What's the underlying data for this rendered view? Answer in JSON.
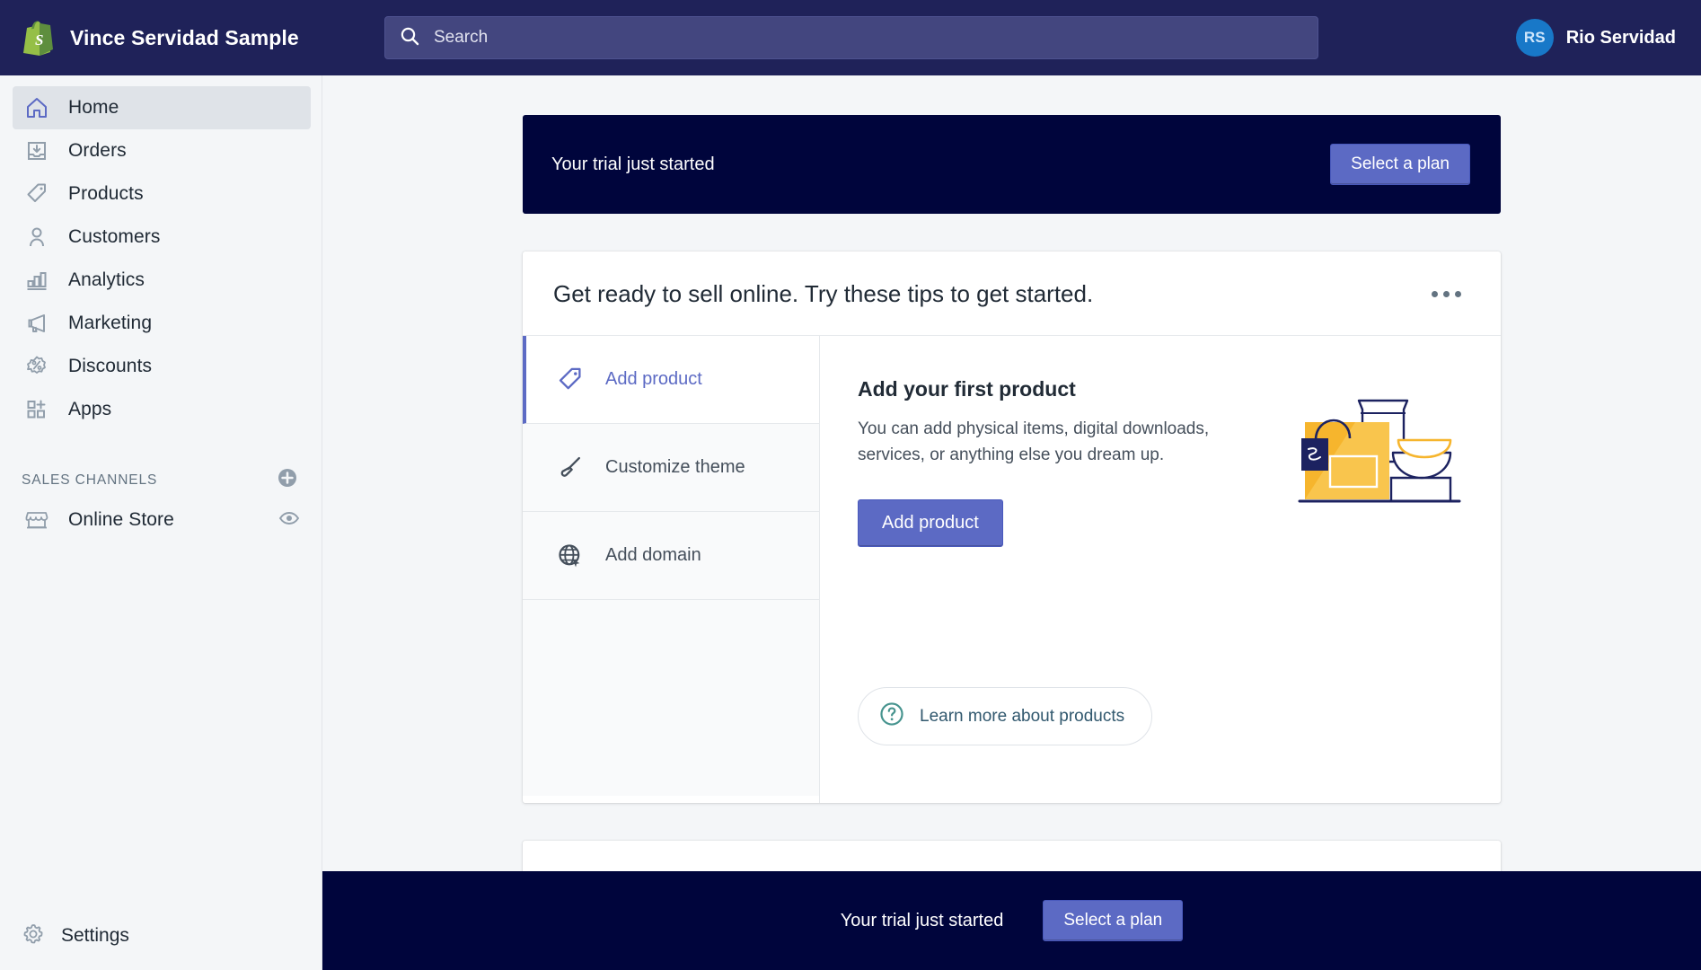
{
  "topbar": {
    "logo_icon": "shopify-bag-icon",
    "store_name": "Vince Servidad Sample",
    "search": {
      "icon": "search-icon",
      "placeholder": "Search",
      "value": ""
    },
    "user": {
      "initials": "RS",
      "name": "Rio Servidad"
    }
  },
  "sidebar": {
    "items": [
      {
        "label": "Home",
        "icon": "home-icon",
        "active": true
      },
      {
        "label": "Orders",
        "icon": "orders-inbox-icon",
        "active": false
      },
      {
        "label": "Products",
        "icon": "product-tag-icon",
        "active": false
      },
      {
        "label": "Customers",
        "icon": "customer-person-icon",
        "active": false
      },
      {
        "label": "Analytics",
        "icon": "analytics-bars-icon",
        "active": false
      },
      {
        "label": "Marketing",
        "icon": "marketing-megaphone-icon",
        "active": false
      },
      {
        "label": "Discounts",
        "icon": "discount-percent-icon",
        "active": false
      },
      {
        "label": "Apps",
        "icon": "apps-grid-plus-icon",
        "active": false
      }
    ],
    "sales_channels": {
      "title": "SALES CHANNELS",
      "add_icon": "plus-circle-icon",
      "channels": [
        {
          "label": "Online Store",
          "icon": "storefront-icon",
          "action_icon": "eye-icon"
        }
      ]
    },
    "settings": {
      "label": "Settings",
      "icon": "gear-icon"
    }
  },
  "main": {
    "trial_banner": {
      "message": "Your trial just started",
      "cta_label": "Select a plan",
      "background_color": "#00053c",
      "cta_color": "#5c6ac4"
    },
    "setup_card": {
      "title": "Get ready to sell online. Try these tips to get started.",
      "menu_icon": "ellipsis-icon",
      "tabs": [
        {
          "label": "Add product",
          "icon": "product-tag-icon",
          "active": true
        },
        {
          "label": "Customize theme",
          "icon": "paintbrush-icon",
          "active": false
        },
        {
          "label": "Add domain",
          "icon": "globe-pointer-icon",
          "active": false
        }
      ],
      "panel": {
        "title": "Add your first product",
        "description": "You can add physical items, digital downloads, services, or anything else you dream up.",
        "cta_label": "Add product",
        "help_label": "Learn more about products",
        "help_icon": "question-circle-icon",
        "illustration": "product-box-jar-bowl-illustration",
        "illustration_accent": "#f6b52d"
      }
    }
  },
  "bottombar": {
    "message": "Your trial just started",
    "cta_label": "Select a plan"
  }
}
